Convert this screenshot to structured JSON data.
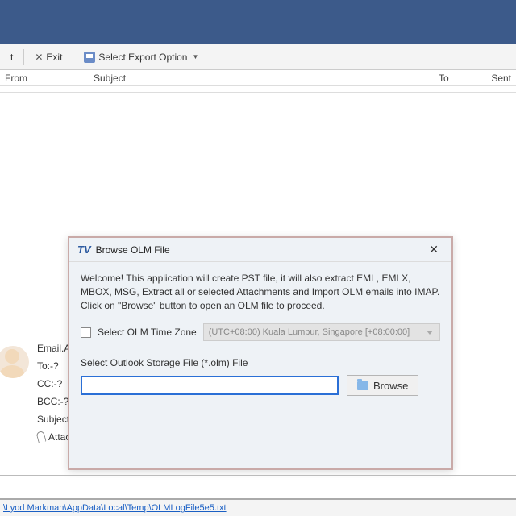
{
  "toolbar": {
    "btn1_suffix": "t",
    "exit_label": "Exit",
    "export_label": "Select Export Option"
  },
  "columns": {
    "from": "From",
    "subject": "Subject",
    "to": "To",
    "sent": "Sent"
  },
  "preview": {
    "email_label": "Email.A",
    "to": "To:-?",
    "cc": "CC:-?",
    "bcc": "BCC:-?",
    "subject": "Subject:-?",
    "attachments": "Attachments:-?"
  },
  "dialog": {
    "logo": "TV",
    "title": "Browse OLM File",
    "welcome": "Welcome! This application will create PST file, it will also extract EML, EMLX, MBOX, MSG, Extract all or selected Attachments and Import OLM emails into IMAP. Click on \"Browse\" button to open an OLM file to proceed.",
    "tz_checkbox_label": "Select OLM Time Zone",
    "tz_value": "(UTC+08:00) Kuala Lumpur, Singapore  [+08:00:00]",
    "file_label": "Select Outlook Storage File (*.olm) File",
    "file_value": "",
    "browse": "Browse"
  },
  "status": {
    "path": "\\Lyod Markman\\AppData\\Local\\Temp\\OLMLogFile5e5.txt"
  }
}
